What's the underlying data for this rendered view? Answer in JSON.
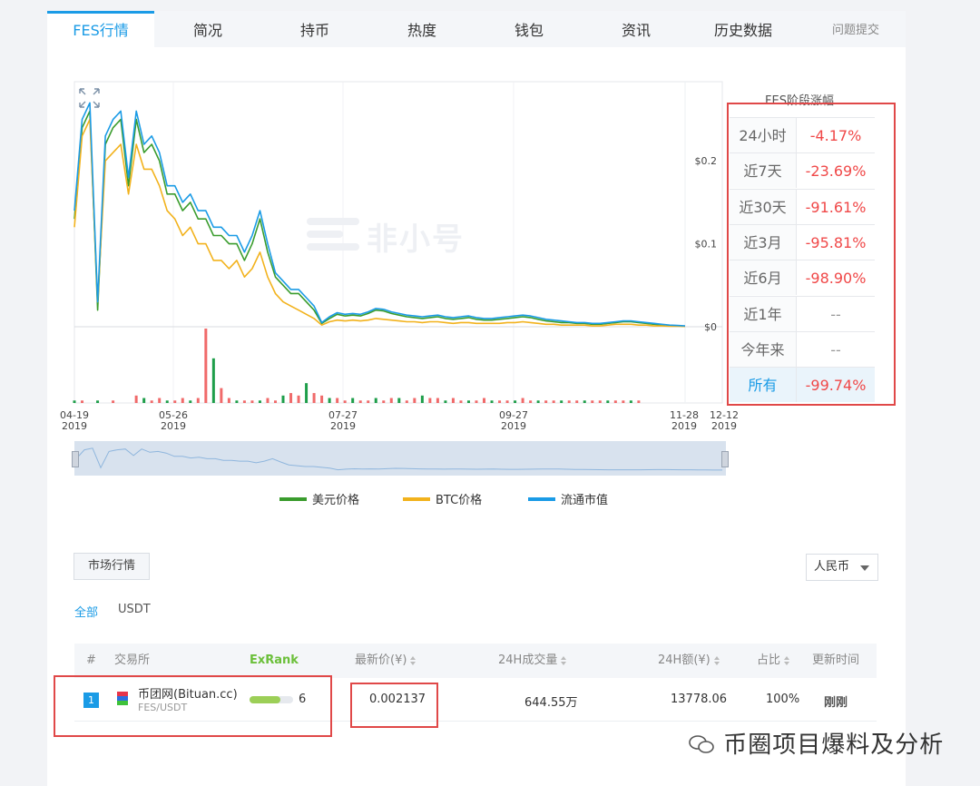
{
  "tabs": [
    "FES行情",
    "简况",
    "持币",
    "热度",
    "钱包",
    "资讯",
    "历史数据"
  ],
  "report_link": "问题提交",
  "watermark": "非小号",
  "chart_data": {
    "type": "line",
    "x_ticks": [
      {
        "date": "04-19",
        "year": "2019"
      },
      {
        "date": "05-26",
        "year": "2019"
      },
      {
        "date": "07-27",
        "year": "2019"
      },
      {
        "date": "09-27",
        "year": "2019"
      },
      {
        "date": "11-28",
        "year": "2019"
      },
      {
        "date": "12-12",
        "year": "2019"
      }
    ],
    "y_ticks": [
      "$0.2",
      "$0.1",
      "$0"
    ],
    "ylim": [
      0,
      0.29
    ],
    "legend": [
      {
        "name": "美元价格",
        "color": "#3a9c2d"
      },
      {
        "name": "BTC价格",
        "color": "#f2b21c"
      },
      {
        "name": "流通市值",
        "color": "#1a9be6"
      }
    ],
    "series": [
      {
        "name": "美元价格",
        "color": "#3a9c2d",
        "values": [
          0.13,
          0.24,
          0.26,
          0.02,
          0.22,
          0.24,
          0.25,
          0.17,
          0.25,
          0.21,
          0.22,
          0.2,
          0.16,
          0.16,
          0.14,
          0.15,
          0.13,
          0.13,
          0.11,
          0.11,
          0.1,
          0.1,
          0.08,
          0.1,
          0.13,
          0.09,
          0.06,
          0.05,
          0.04,
          0.04,
          0.03,
          0.02,
          0.004,
          0.01,
          0.015,
          0.013,
          0.014,
          0.013,
          0.016,
          0.02,
          0.019,
          0.016,
          0.014,
          0.012,
          0.011,
          0.01,
          0.011,
          0.012,
          0.01,
          0.009,
          0.01,
          0.011,
          0.009,
          0.008,
          0.008,
          0.009,
          0.01,
          0.011,
          0.012,
          0.011,
          0.009,
          0.007,
          0.006,
          0.005,
          0.005,
          0.004,
          0.004,
          0.003,
          0.003,
          0.004,
          0.005,
          0.006,
          0.006,
          0.005,
          0.004,
          0.003,
          0.002,
          0.001,
          0.001,
          0.0005
        ]
      },
      {
        "name": "BTC价格",
        "color": "#f2b21c",
        "values": [
          0.12,
          0.23,
          0.25,
          0.03,
          0.2,
          0.21,
          0.22,
          0.16,
          0.22,
          0.19,
          0.19,
          0.17,
          0.14,
          0.13,
          0.11,
          0.12,
          0.1,
          0.1,
          0.08,
          0.08,
          0.07,
          0.08,
          0.06,
          0.07,
          0.09,
          0.06,
          0.04,
          0.03,
          0.025,
          0.02,
          0.015,
          0.01,
          0.002,
          0.006,
          0.008,
          0.007,
          0.008,
          0.007,
          0.008,
          0.01,
          0.009,
          0.008,
          0.007,
          0.006,
          0.006,
          0.005,
          0.006,
          0.006,
          0.005,
          0.004,
          0.005,
          0.005,
          0.004,
          0.004,
          0.004,
          0.004,
          0.005,
          0.005,
          0.006,
          0.005,
          0.004,
          0.003,
          0.003,
          0.002,
          0.002,
          0.002,
          0.002,
          0.001,
          0.001,
          0.002,
          0.003,
          0.003,
          0.003,
          0.002,
          0.002,
          0.001,
          0.001,
          0.0005,
          0.0005,
          0.0003
        ]
      },
      {
        "name": "流通市值",
        "color": "#1a9be6",
        "values": [
          0.14,
          0.25,
          0.27,
          0.03,
          0.23,
          0.25,
          0.26,
          0.18,
          0.26,
          0.22,
          0.23,
          0.21,
          0.17,
          0.17,
          0.15,
          0.16,
          0.14,
          0.14,
          0.12,
          0.12,
          0.11,
          0.11,
          0.09,
          0.11,
          0.14,
          0.1,
          0.065,
          0.055,
          0.045,
          0.045,
          0.035,
          0.025,
          0.005,
          0.012,
          0.017,
          0.015,
          0.016,
          0.015,
          0.018,
          0.022,
          0.021,
          0.018,
          0.016,
          0.014,
          0.013,
          0.012,
          0.013,
          0.014,
          0.012,
          0.011,
          0.012,
          0.013,
          0.011,
          0.01,
          0.01,
          0.011,
          0.012,
          0.013,
          0.014,
          0.013,
          0.011,
          0.009,
          0.008,
          0.007,
          0.006,
          0.005,
          0.005,
          0.004,
          0.004,
          0.005,
          0.006,
          0.007,
          0.007,
          0.006,
          0.005,
          0.004,
          0.003,
          0.002,
          0.0015,
          0.001
        ]
      }
    ],
    "volume": [
      1,
      1,
      0,
      1,
      0,
      1,
      0,
      0,
      3,
      2,
      1,
      2,
      1,
      1,
      2,
      1,
      2,
      30,
      18,
      6,
      2,
      1,
      1,
      1,
      1,
      2,
      1,
      3,
      4,
      3,
      8,
      4,
      3,
      2,
      2,
      1,
      2,
      1,
      1,
      2,
      1,
      2,
      2,
      1,
      2,
      3,
      2,
      2,
      1,
      2,
      1,
      1,
      1,
      2,
      1,
      1,
      1,
      1,
      2,
      1,
      1,
      1,
      1,
      1,
      1,
      1,
      1,
      1,
      1,
      1,
      1,
      1,
      1,
      1,
      0,
      0,
      0,
      0,
      0,
      0
    ]
  },
  "stage_change": {
    "title": "FES阶段涨幅",
    "rows": [
      {
        "label": "24小时",
        "value": "-4.17%"
      },
      {
        "label": "近7天",
        "value": "-23.69%"
      },
      {
        "label": "近30天",
        "value": "-91.61%"
      },
      {
        "label": "近3月",
        "value": "-95.81%"
      },
      {
        "label": "近6月",
        "value": "-98.90%"
      },
      {
        "label": "近1年",
        "value": "--"
      },
      {
        "label": "今年来",
        "value": "--"
      },
      {
        "label": "所有",
        "value": "-99.74%"
      }
    ]
  },
  "market": {
    "section_button": "市场行情",
    "currency": "人民币",
    "filters": [
      "全部",
      "USDT"
    ],
    "headers": [
      "#",
      "交易所",
      "ExRank",
      "最新价(¥)",
      "24H成交量",
      "24H额(¥)",
      "占比",
      "更新时间"
    ],
    "rows": [
      {
        "rank": "1",
        "exchange": "币团网(Bituan.cc)",
        "pair": "FES/USDT",
        "exrank": "6",
        "exrank_fill": 0.7,
        "price": "0.002137",
        "volume": "644.55万",
        "amount": "13778.06",
        "share": "100%",
        "updated": "刚刚"
      }
    ]
  },
  "footer_watermark": "币圈项目爆料及分析"
}
